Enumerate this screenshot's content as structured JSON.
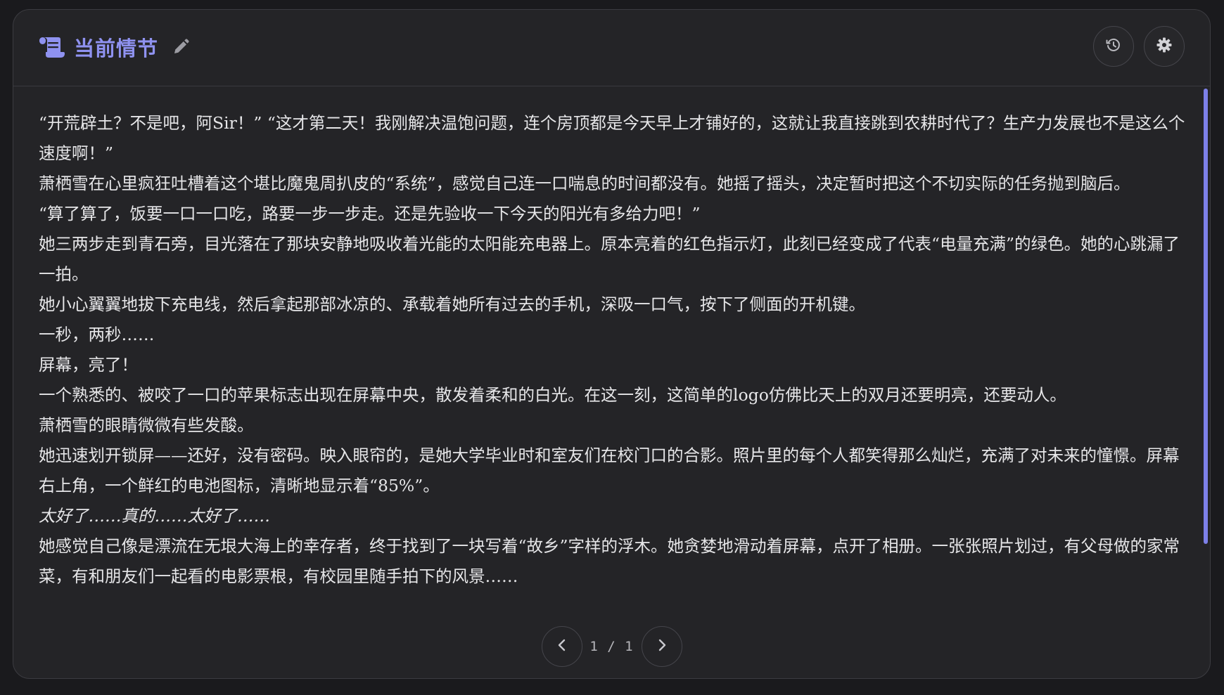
{
  "header": {
    "title": "当前情节",
    "icons": {
      "title_icon": "scroll-icon",
      "edit": "pencil-icon",
      "history": "history-icon",
      "settings": "gear-icon"
    },
    "accent_color": "#8f92f0"
  },
  "story": {
    "paragraphs": [
      {
        "text": "“开荒辟土？不是吧，阿Sir！” “这才第二天！我刚解决温饱问题，连个房顶都是今天早上才铺好的，这就让我直接跳到农耕时代了？生产力发展也不是这么个速度啊！”",
        "italic": false
      },
      {
        "text": "萧栖雪在心里疯狂吐槽着这个堪比魔鬼周扒皮的“系统”，感觉自己连一口喘息的时间都没有。她摇了摇头，决定暂时把这个不切实际的任务抛到脑后。",
        "italic": false
      },
      {
        "text": "“算了算了，饭要一口一口吃，路要一步一步走。还是先验收一下今天的阳光有多给力吧！”",
        "italic": false
      },
      {
        "text": "她三两步走到青石旁，目光落在了那块安静地吸收着光能的太阳能充电器上。原本亮着的红色指示灯，此刻已经变成了代表“电量充满”的绿色。她的心跳漏了一拍。",
        "italic": false
      },
      {
        "text": "她小心翼翼地拔下充电线，然后拿起那部冰凉的、承载着她所有过去的手机，深吸一口气，按下了侧面的开机键。",
        "italic": false
      },
      {
        "text": "一秒，两秒……",
        "italic": false
      },
      {
        "text": "屏幕，亮了！",
        "italic": false
      },
      {
        "text": "一个熟悉的、被咬了一口的苹果标志出现在屏幕中央，散发着柔和的白光。在这一刻，这简单的logo仿佛比天上的双月还要明亮，还要动人。",
        "italic": false
      },
      {
        "text": "萧栖雪的眼睛微微有些发酸。",
        "italic": false
      },
      {
        "text": "她迅速划开锁屏——还好，没有密码。映入眼帘的，是她大学毕业时和室友们在校门口的合影。照片里的每个人都笑得那么灿烂，充满了对未来的憧憬。屏幕右上角，一个鲜红的电池图标，清晰地显示着“85%”。",
        "italic": false
      },
      {
        "text": "太好了……真的……太好了……",
        "italic": true
      },
      {
        "text": "她感觉自己像是漂流在无垠大海上的幸存者，终于找到了一块写着“故乡”字样的浮木。她贪婪地滑动着屏幕，点开了相册。一张张照片划过，有父母做的家常菜，有和朋友们一起看的电影票根，有校园里随手拍下的风景……",
        "italic": false
      }
    ]
  },
  "pagination": {
    "current": "1",
    "separator": "/",
    "total": "1",
    "prev_icon": "chevron-left-icon",
    "next_icon": "chevron-right-icon"
  }
}
